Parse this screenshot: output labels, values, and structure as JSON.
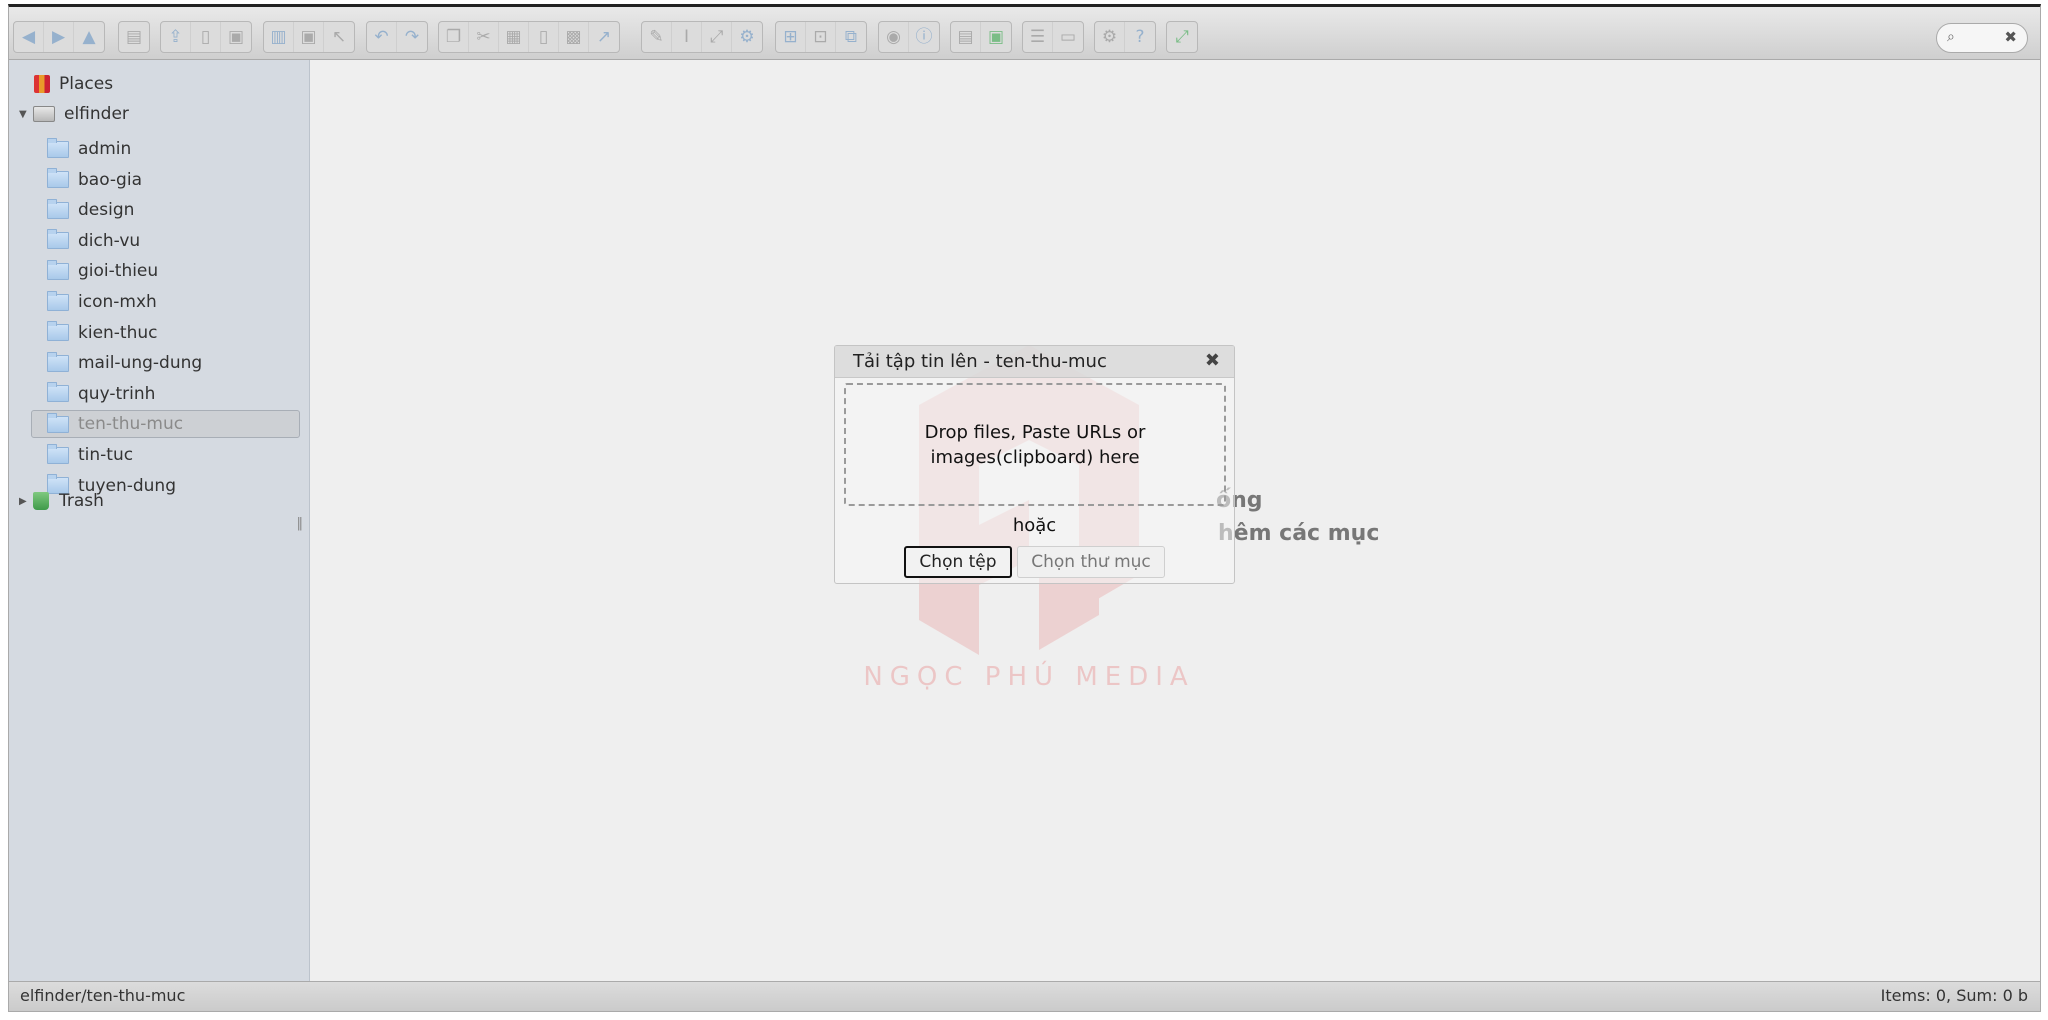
{
  "toolbar": {
    "groups": [
      {
        "buttons": [
          "back-icon",
          "forward-icon",
          "up-icon"
        ]
      },
      {
        "buttons": [
          "home-icon"
        ]
      },
      {
        "buttons": [
          "upload-icon",
          "new-file-icon",
          "save-icon"
        ]
      },
      {
        "buttons": [
          "open-icon",
          "download-icon",
          "select-icon"
        ]
      },
      {
        "buttons": [
          "undo-icon",
          "redo-icon"
        ]
      },
      {
        "buttons": [
          "copy-icon",
          "cut-icon",
          "paste-icon",
          "duplicate-icon",
          "delete-icon",
          "restore-icon"
        ]
      },
      {
        "buttons": [
          "edit-icon",
          "rename-icon",
          "resize-icon",
          "archive-icon"
        ]
      },
      {
        "buttons": [
          "select-all-icon",
          "select-none-icon",
          "select-invert-icon"
        ]
      },
      {
        "buttons": [
          "view-icon",
          "info-icon"
        ]
      },
      {
        "buttons": [
          "extract-icon",
          "chmod-icon"
        ]
      },
      {
        "buttons": [
          "list-view-icon",
          "sort-icon"
        ]
      },
      {
        "buttons": [
          "settings-icon",
          "help-icon"
        ]
      },
      {
        "buttons": [
          "fullscreen-icon"
        ]
      }
    ],
    "search_placeholder": ""
  },
  "sidebar": {
    "places_label": "Places",
    "root_label": "elfinder",
    "folders": [
      "admin",
      "bao-gia",
      "design",
      "dich-vu",
      "gioi-thieu",
      "icon-mxh",
      "kien-thuc",
      "mail-ung-dung",
      "quy-trinh",
      "ten-thu-muc",
      "tin-tuc",
      "tuyen-dung"
    ],
    "active_folder": "ten-thu-muc",
    "trash_label": "Trash"
  },
  "workzone": {
    "empty_line1_partial": "ống",
    "empty_line2_partial": "hêm các mục"
  },
  "watermark": {
    "text": "NGỌC PHÚ MEDIA",
    "color": "#e23a3a"
  },
  "dialog": {
    "title": "Tải tập tin lên - ten-thu-muc",
    "dropzone_text": "Drop files, Paste URLs or images(clipboard) here",
    "or_text": "hoặc",
    "choose_files_label": "Chọn tệp",
    "choose_folder_label": "Chọn thư mục"
  },
  "statusbar": {
    "path": "elfinder/ten-thu-muc",
    "summary": "Items: 0, Sum: 0 b"
  }
}
